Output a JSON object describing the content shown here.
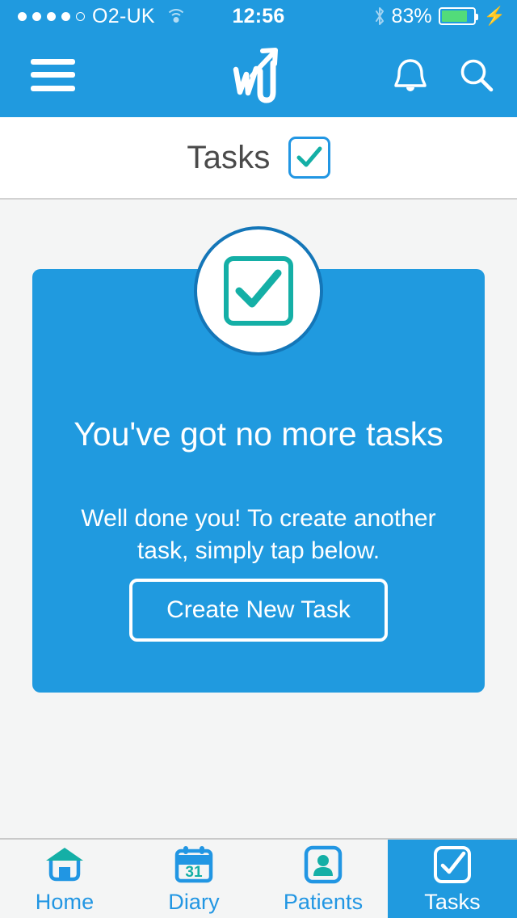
{
  "status_bar": {
    "signal_dots_total": 5,
    "signal_dots_filled": 4,
    "carrier": "O2-UK",
    "wifi": "wifi-icon",
    "time": "12:56",
    "bluetooth": "bluetooth-icon",
    "battery_percent": "83%",
    "battery_level": 83,
    "charging": true,
    "charge_glyph": "⚡",
    "battery_color": "#52dc7a"
  },
  "nav": {
    "menu_icon": "hamburger-menu-icon",
    "logo": "wu-brand-logo",
    "notifications_icon": "bell-icon",
    "search_icon": "search-icon",
    "background_color": "#209ADF"
  },
  "header": {
    "title": "Tasks",
    "check_icon": "checkbox-check-icon",
    "check_border_color": "#2196e3",
    "check_mark_color": "#14AFA6"
  },
  "card": {
    "badge_icon": "checkbox-check-badge-icon",
    "title": "You've got no more tasks",
    "subtitle": "Well done you! To create another task, simply tap below.",
    "cta_label": "Create New Task",
    "background_color": "#209ADF",
    "accent_color": "#14AFA6"
  },
  "tabs": [
    {
      "label": "Home",
      "icon": "home-icon",
      "active": false
    },
    {
      "label": "Diary",
      "icon": "calendar-icon",
      "badge_day": "31",
      "active": false
    },
    {
      "label": "Patients",
      "icon": "person-icon",
      "active": false
    },
    {
      "label": "Tasks",
      "icon": "checkbox-icon",
      "active": true
    }
  ],
  "colors": {
    "brand_blue": "#209ADF",
    "link_blue": "#2196e3",
    "teal": "#14AFA6",
    "page_bg": "#f4f5f5",
    "title_text": "#4a4a4a"
  }
}
